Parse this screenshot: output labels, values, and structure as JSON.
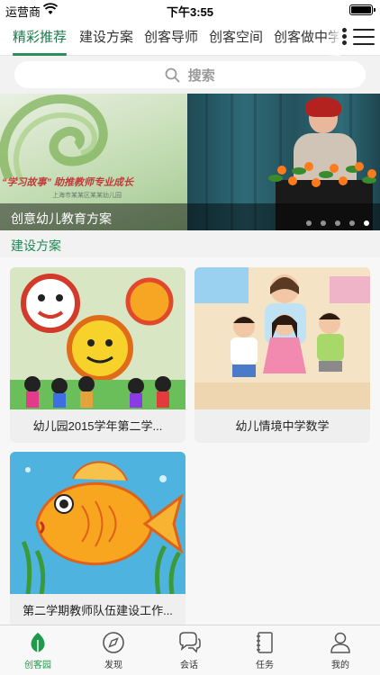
{
  "status_bar": {
    "carrier": "运营商",
    "time": "下午3:55"
  },
  "tabs": [
    {
      "label": "精彩推荐",
      "active": true
    },
    {
      "label": "建设方案",
      "active": false
    },
    {
      "label": "创客导师",
      "active": false
    },
    {
      "label": "创客空间",
      "active": false
    },
    {
      "label": "创客做中学",
      "active": false
    }
  ],
  "search": {
    "placeholder": "搜索"
  },
  "banner": {
    "caption": "创意幼儿教育方案",
    "image_text": "“学习故事” 助推教师专业成长",
    "image_subtext": "上海市某某区某某幼儿园",
    "slide_count": 5,
    "active_slide": 5
  },
  "section": {
    "title": "建设方案"
  },
  "cards": [
    {
      "caption": "幼儿园2015学年第二学..."
    },
    {
      "caption": "幼儿情境中学数学"
    },
    {
      "caption": "第二学期教师队伍建设工作..."
    }
  ],
  "tabbar": [
    {
      "label": "创客园",
      "icon": "leaf-icon",
      "active": true
    },
    {
      "label": "发现",
      "icon": "compass-icon",
      "active": false
    },
    {
      "label": "会话",
      "icon": "chat-bubble-icon",
      "active": false
    },
    {
      "label": "任务",
      "icon": "notebook-icon",
      "active": false
    },
    {
      "label": "我的",
      "icon": "person-icon",
      "active": false
    }
  ],
  "colors": {
    "accent": "#1f9a4a",
    "tab_underline": "#2b8f55",
    "section_title": "#1f8a55"
  }
}
